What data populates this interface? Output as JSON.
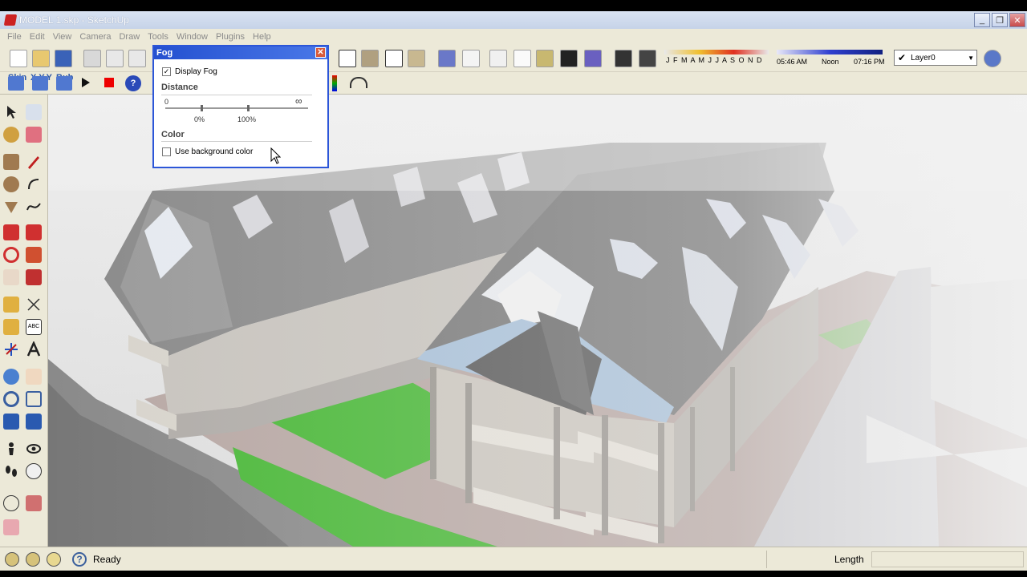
{
  "window": {
    "title": "MODEL 1.skp - SketchUp",
    "controls": [
      "_",
      "❐",
      "✕"
    ]
  },
  "menu": [
    "File",
    "Edit",
    "View",
    "Camera",
    "Draw",
    "Tools",
    "Window",
    "Plugins",
    "Help"
  ],
  "toolbar": {
    "plugin_labels": [
      "Skin",
      "X,Y,Y",
      "Bub"
    ],
    "shadow_months": "J F M A M J J A S O N D",
    "shadow_time_start": "05:46 AM",
    "shadow_time_mid": "Noon",
    "shadow_time_end": "07:16 PM",
    "layer": "Layer0"
  },
  "fog": {
    "title": "Fog",
    "display_label": "Display Fog",
    "display_checked": "✓",
    "distance_heading": "Distance",
    "distance_start": "0",
    "distance_end": "∞",
    "tick_0": "0%",
    "tick_100": "100%",
    "color_heading": "Color",
    "bg_color_label": "Use background color"
  },
  "status": {
    "text": "Ready",
    "length_label": "Length",
    "length_value": ""
  }
}
